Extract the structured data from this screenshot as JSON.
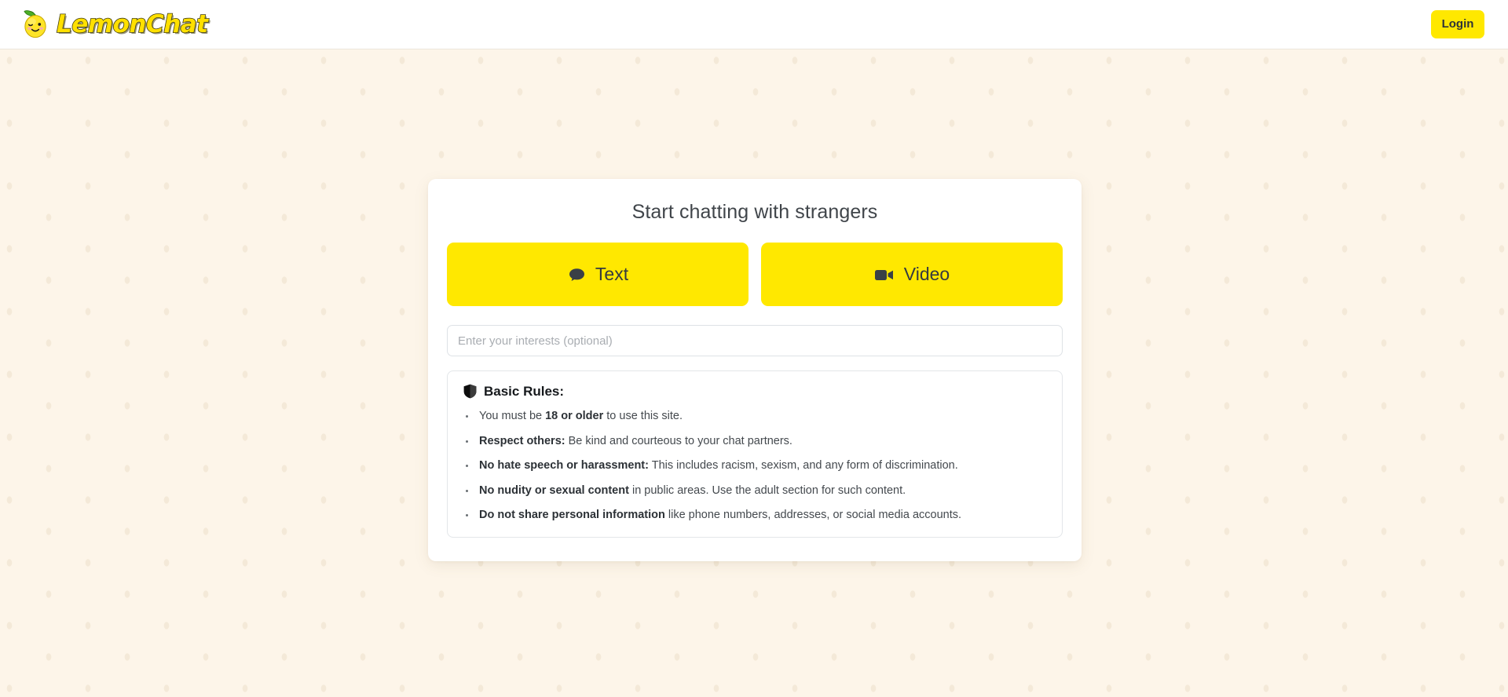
{
  "header": {
    "brand_name": "LemonChat",
    "logo_icon": "winking-lemon-icon",
    "login_label": "Login"
  },
  "main": {
    "title": "Start chatting with strangers",
    "mode_buttons": [
      {
        "label": "Text",
        "icon": "chat-bubble-icon"
      },
      {
        "label": "Video",
        "icon": "video-camera-icon"
      }
    ],
    "interests": {
      "placeholder": "Enter your interests (optional)",
      "value": ""
    },
    "rules": {
      "icon": "shield-icon",
      "heading": "Basic Rules:",
      "items": [
        {
          "lead": "",
          "bold": "",
          "text_before": "You must be ",
          "bold_mid": "18 or older",
          "text_after": " to use this site."
        },
        {
          "bold": "Respect others:",
          "rest": " Be kind and courteous to your chat partners."
        },
        {
          "bold": "No hate speech or harassment:",
          "rest": " This includes racism, sexism, and any form of discrimination."
        },
        {
          "bold": "No nudity or sexual content",
          "rest": " in public areas. Use the adult section for such content."
        },
        {
          "bold": "Do not share personal information",
          "rest": " like phone numbers, addresses, or social media accounts."
        }
      ]
    }
  },
  "colors": {
    "brand_yellow": "#ffe800",
    "page_background": "#fdf5e9",
    "card_background": "#ffffff",
    "text_dark": "#343a40"
  }
}
